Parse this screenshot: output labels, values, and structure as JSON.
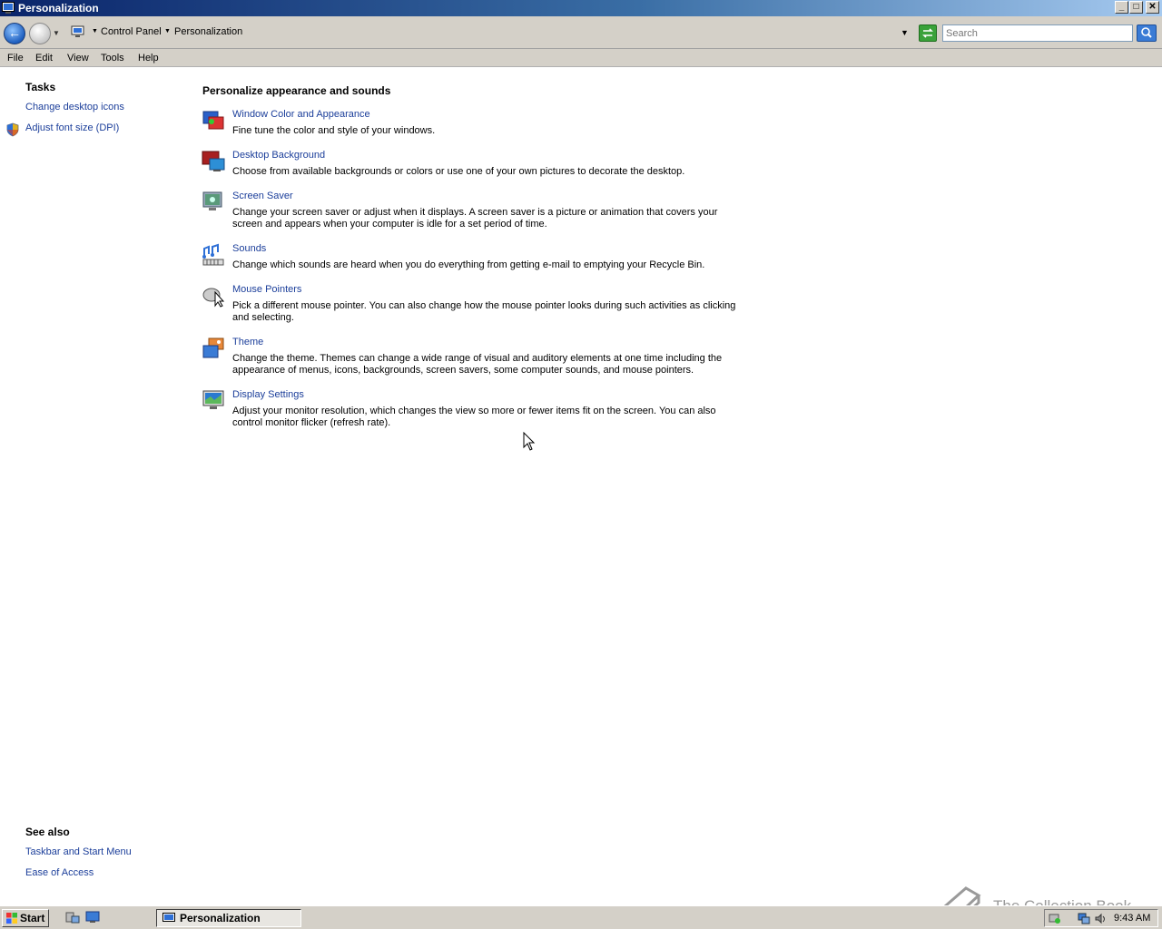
{
  "window": {
    "title": "Personalization"
  },
  "address": {
    "crumbs": [
      "Control Panel",
      "Personalization"
    ],
    "search_placeholder": "Search"
  },
  "menu": [
    "File",
    "Edit",
    "View",
    "Tools",
    "Help"
  ],
  "sidebar": {
    "tasks_heading": "Tasks",
    "tasks": [
      "Change desktop icons",
      "Adjust font size (DPI)"
    ],
    "see_also_heading": "See also",
    "see_also": [
      "Taskbar and Start Menu",
      "Ease of Access"
    ]
  },
  "main": {
    "heading": "Personalize appearance and sounds",
    "items": [
      {
        "title": "Window Color and Appearance",
        "desc": "Fine tune the color and style of your windows."
      },
      {
        "title": "Desktop Background",
        "desc": "Choose from available backgrounds or colors or use one of your own pictures to decorate the desktop."
      },
      {
        "title": "Screen Saver",
        "desc": "Change your screen saver or adjust when it displays. A screen saver is a picture or animation that covers your screen and appears when your computer is idle for a set period of time."
      },
      {
        "title": "Sounds",
        "desc": "Change which sounds are heard when you do everything from getting e-mail to emptying your Recycle Bin."
      },
      {
        "title": "Mouse Pointers",
        "desc": "Pick a different mouse pointer. You can also change how the mouse pointer looks during such activities as clicking and selecting."
      },
      {
        "title": "Theme",
        "desc": "Change the theme. Themes can change a wide range of visual and auditory elements at one time including the appearance of menus, icons, backgrounds, screen savers, some computer sounds, and mouse pointers."
      },
      {
        "title": "Display Settings",
        "desc": "Adjust your monitor resolution, which changes the view so more or fewer items fit on the screen. You can also control monitor flicker (refresh rate)."
      }
    ]
  },
  "taskbar": {
    "start_label": "Start",
    "task_label": "Personalization",
    "clock": "9:43 AM"
  },
  "watermark": "The Collection Book",
  "colors": {
    "link": "#1b3e9a",
    "chrome": "#d4d0c8",
    "titlebar_start": "#0a246a"
  }
}
